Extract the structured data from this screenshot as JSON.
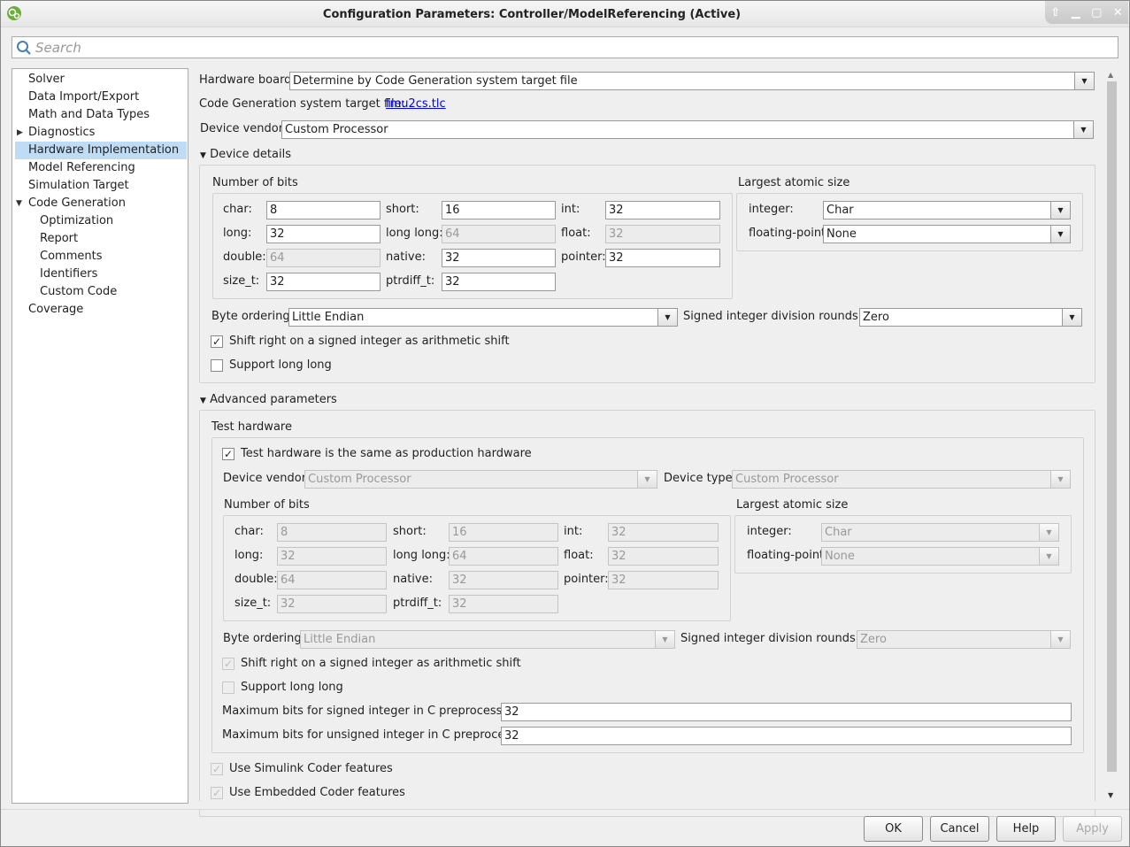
{
  "window": {
    "title": "Configuration Parameters: Controller/ModelReferencing (Active)",
    "controls": [
      "restore-up",
      "minimize",
      "maximize",
      "close"
    ]
  },
  "search": {
    "placeholder": "Search"
  },
  "tree": [
    {
      "label": "Solver",
      "level": 0
    },
    {
      "label": "Data Import/Export",
      "level": 0
    },
    {
      "label": "Math and Data Types",
      "level": 0
    },
    {
      "label": "Diagnostics",
      "level": 0,
      "expander": "collapsed"
    },
    {
      "label": "Hardware Implementation",
      "level": 0,
      "selected": true
    },
    {
      "label": "Model Referencing",
      "level": 0
    },
    {
      "label": "Simulation Target",
      "level": 0
    },
    {
      "label": "Code Generation",
      "level": 0,
      "expander": "expanded"
    },
    {
      "label": "Optimization",
      "level": 1
    },
    {
      "label": "Report",
      "level": 1
    },
    {
      "label": "Comments",
      "level": 1
    },
    {
      "label": "Identifiers",
      "level": 1
    },
    {
      "label": "Custom Code",
      "level": 1
    },
    {
      "label": "Coverage",
      "level": 0
    }
  ],
  "main": {
    "hardware_board": {
      "label": "Hardware board:",
      "value": "Determine by Code Generation system target file"
    },
    "target_file": {
      "label": "Code Generation system target file:",
      "link": "fmu2cs.tlc"
    },
    "device_vendor": {
      "label": "Device vendor:",
      "value": "Custom Processor"
    },
    "device_details": {
      "title": "Device details",
      "bits_title": "Number of bits",
      "bits": {
        "char": {
          "label": "char:",
          "value": "8"
        },
        "short": {
          "label": "short:",
          "value": "16"
        },
        "int": {
          "label": "int:",
          "value": "32"
        },
        "long": {
          "label": "long:",
          "value": "32"
        },
        "longlong": {
          "label": "long long:",
          "value": "64"
        },
        "float": {
          "label": "float:",
          "value": "32"
        },
        "double": {
          "label": "double:",
          "value": "64"
        },
        "native": {
          "label": "native:",
          "value": "32"
        },
        "pointer": {
          "label": "pointer:",
          "value": "32"
        },
        "size_t": {
          "label": "size_t:",
          "value": "32"
        },
        "ptrdiff_t": {
          "label": "ptrdiff_t:",
          "value": "32"
        }
      },
      "atomic_title": "Largest atomic size",
      "atomic_integer": {
        "label": "integer:",
        "value": "Char"
      },
      "atomic_float": {
        "label": "floating-point:",
        "value": "None"
      },
      "byte_ordering": {
        "label": "Byte ordering:",
        "value": "Little Endian"
      },
      "div_rounds": {
        "label": "Signed integer division rounds to:",
        "value": "Zero"
      },
      "shift_right": {
        "label": "Shift right on a signed integer as arithmetic shift",
        "checked": true
      },
      "long_long": {
        "label": "Support long long",
        "checked": false
      }
    },
    "advanced": {
      "title": "Advanced parameters",
      "test_title": "Test hardware",
      "same_as_prod": {
        "label": "Test hardware is the same as production hardware",
        "checked": true
      },
      "device_vendor": {
        "label": "Device vendor:",
        "value": "Custom Processor"
      },
      "device_type": {
        "label": "Device type:",
        "value": "Custom Processor"
      },
      "bits_title": "Number of bits",
      "bits": {
        "char": {
          "label": "char:",
          "value": "8"
        },
        "short": {
          "label": "short:",
          "value": "16"
        },
        "int": {
          "label": "int:",
          "value": "32"
        },
        "long": {
          "label": "long:",
          "value": "32"
        },
        "longlong": {
          "label": "long long:",
          "value": "64"
        },
        "float": {
          "label": "float:",
          "value": "32"
        },
        "double": {
          "label": "double:",
          "value": "64"
        },
        "native": {
          "label": "native:",
          "value": "32"
        },
        "pointer": {
          "label": "pointer:",
          "value": "32"
        },
        "size_t": {
          "label": "size_t:",
          "value": "32"
        },
        "ptrdiff_t": {
          "label": "ptrdiff_t:",
          "value": "32"
        }
      },
      "atomic_title": "Largest atomic size",
      "atomic_integer": {
        "label": "integer:",
        "value": "Char"
      },
      "atomic_float": {
        "label": "floating-point:",
        "value": "None"
      },
      "byte_ordering": {
        "label": "Byte ordering:",
        "value": "Little Endian"
      },
      "div_rounds": {
        "label": "Signed integer division rounds to:",
        "value": "Zero"
      },
      "shift_right": {
        "label": "Shift right on a signed integer as arithmetic shift",
        "checked": true
      },
      "long_long": {
        "label": "Support long long",
        "checked": false
      },
      "max_signed": {
        "label": "Maximum bits for signed integer in C preprocessor:",
        "value": "32"
      },
      "max_unsigned": {
        "label": "Maximum bits for unsigned integer in C preprocessor:",
        "value": "32"
      },
      "simulink_coder": {
        "label": "Use Simulink Coder features",
        "checked": true
      },
      "embedded_coder": {
        "label": "Use Embedded Coder features",
        "checked": true
      }
    }
  },
  "buttons": {
    "ok": "OK",
    "cancel": "Cancel",
    "help": "Help",
    "apply": "Apply"
  }
}
